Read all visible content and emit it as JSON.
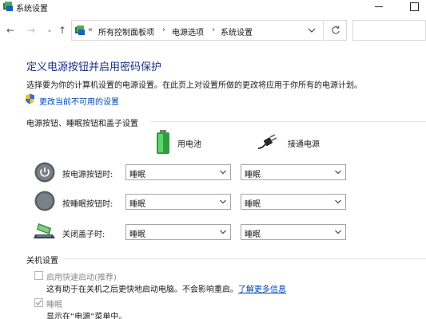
{
  "window": {
    "title": "系统设置",
    "icon": "control-panel-icon"
  },
  "nav": {
    "back": "←",
    "forward": "→",
    "dropdown": "⌄",
    "up": "↑"
  },
  "address": {
    "overflow": "«",
    "crumbs": [
      "所有控制面板项",
      "电源选项",
      "系统设置"
    ],
    "separator": "›"
  },
  "page": {
    "title": "定义电源按钮并启用密码保护",
    "description": "选择要为你的计算机设置的电源设置。在此页上对设置所做的更改将应用于你所有的电源计划。",
    "change_link": "更改当前不可用的设置"
  },
  "power_section": {
    "heading": "电源按钮、睡眠按钮和盖子设置",
    "columns": [
      "用电池",
      "接通电源"
    ],
    "rows": [
      {
        "label": "按电源按钮时:",
        "icon": "power-button-icon",
        "battery": "睡眠",
        "plugged": "睡眠"
      },
      {
        "label": "按睡眠按钮时:",
        "icon": "sleep-button-icon",
        "battery": "睡眠",
        "plugged": "睡眠"
      },
      {
        "label": "关闭盖子时:",
        "icon": "laptop-lid-icon",
        "battery": "睡眠",
        "plugged": "睡眠"
      }
    ]
  },
  "shutdown_section": {
    "heading": "关机设置",
    "fast_startup": {
      "label": "启用快速启动(推荐)",
      "description": "这有助于在关机之后更快地启动电脑。不会影响重启。",
      "link": "了解更多信息",
      "checked": false
    },
    "sleep": {
      "label": "睡眠",
      "description": "显示在“电源”菜单中。",
      "checked": true
    }
  },
  "colors": {
    "title_blue": "#1e3287",
    "link_blue": "#0046b4",
    "battery_green": "#36b54a"
  }
}
